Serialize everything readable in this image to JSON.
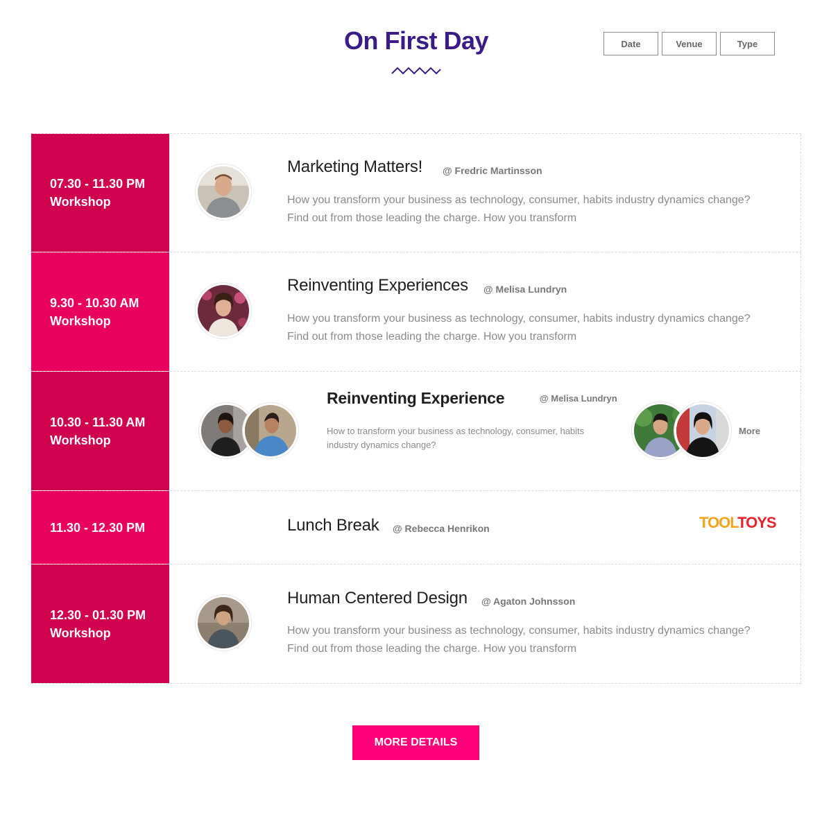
{
  "header": {
    "title": "On First Day",
    "filters": [
      "Date",
      "Venue",
      "Type"
    ]
  },
  "sessions": [
    {
      "time": "07.30 - 11.30 PM",
      "kind": "Workshop",
      "title": "Marketing Matters!",
      "speaker": "@ Fredric Martinsson",
      "description_line1": "How you transform your business as technology, consumer, habits industry dynamics change?",
      "description_line2": "Find out from those leading the charge. How you transform"
    },
    {
      "time": "9.30 - 10.30 AM",
      "kind": "Workshop",
      "title": "Reinventing Experiences",
      "speaker": "@ Melisa Lundryn",
      "description_line1": "How you transform your business as technology, consumer, habits industry dynamics change?",
      "description_line2": "Find out from those leading the charge. How you transform"
    },
    {
      "time": "10.30 - 11.30 AM",
      "kind": "Workshop",
      "title": "Reinventing Experience",
      "speaker": "@ Melisa Lundryn",
      "description_line1": "How to transform your business as technology, consumer, habits",
      "description_line2": "industry dynamics change?",
      "more_label": "More"
    },
    {
      "time": "11.30 - 12.30 PM",
      "title": "Lunch Break",
      "speaker": "@ Rebecca Henrikon",
      "sponsor_logo_part1": "TOOL",
      "sponsor_logo_part2": "TOYS"
    },
    {
      "time": "12.30 - 01.30 PM",
      "kind": "Workshop",
      "title": "Human Centered Design",
      "speaker": "@ Agaton Johnsson",
      "description_line1": "How you transform your business as technology, consumer, habits industry dynamics change?",
      "description_line2": "Find out from those leading the charge. How you transform"
    }
  ],
  "footer": {
    "more_details": "MORE DETAILS"
  },
  "colors": {
    "title": "#3b1b86",
    "time_dark": "#d0024f",
    "time_light": "#e8025e",
    "button": "#ff007a",
    "logo_orange": "#f6a21a",
    "logo_red": "#e8212b"
  }
}
